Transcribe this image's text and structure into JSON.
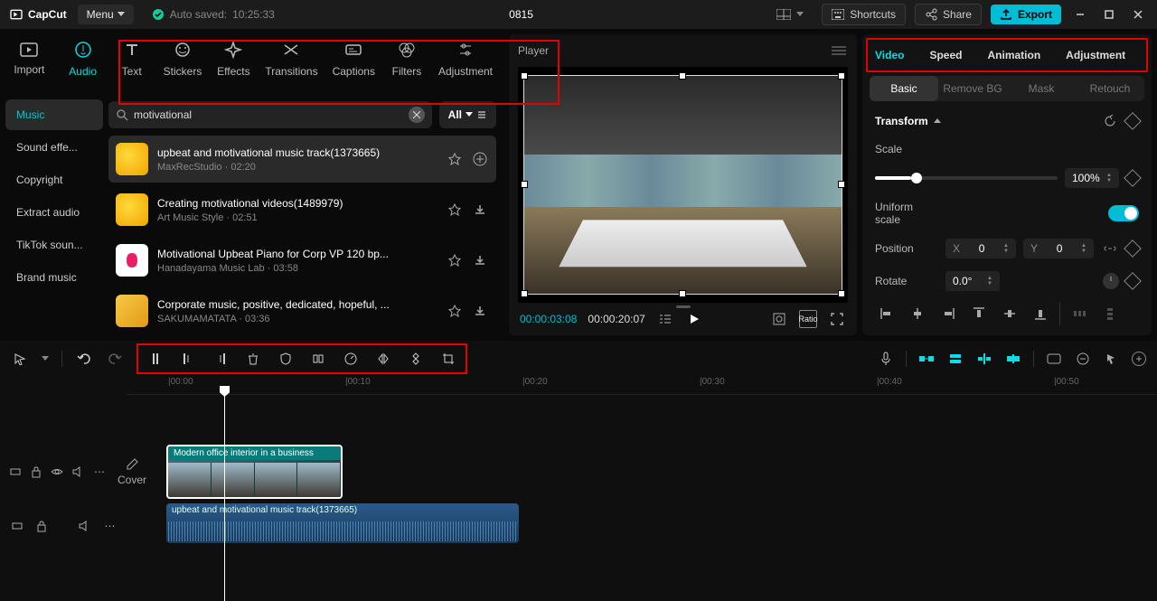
{
  "app": {
    "brand": "CapCut",
    "menu": "Menu",
    "autosave_prefix": "Auto saved:",
    "autosave_time": "10:25:33",
    "project_title": "0815",
    "shortcuts": "Shortcuts",
    "share": "Share",
    "export": "Export"
  },
  "nav": {
    "import": "Import",
    "tabs": [
      "Audio",
      "Text",
      "Stickers",
      "Effects",
      "Transitions",
      "Captions",
      "Filters",
      "Adjustment"
    ]
  },
  "sidebar": {
    "items": [
      "Music",
      "Sound effe...",
      "Copyright",
      "Extract audio",
      "TikTok soun...",
      "Brand music"
    ]
  },
  "search": {
    "value": "motivational",
    "all": "All"
  },
  "tracks": [
    {
      "title": "upbeat and motivational music track(1373665)",
      "artist": "MaxRecStudio",
      "duration": "02:20",
      "thumb": "sun",
      "action": "add"
    },
    {
      "title": "Creating motivational videos(1489979)",
      "artist": "Art Music Style",
      "duration": "02:51",
      "thumb": "sun",
      "action": "download"
    },
    {
      "title": "Motivational Upbeat Piano for Corp VP 120 bp...",
      "artist": "Hanadayama Music Lab",
      "duration": "03:58",
      "thumb": "pink",
      "action": "download"
    },
    {
      "title": "Corporate music, positive, dedicated, hopeful, ...",
      "artist": "SAKUMAMATATA",
      "duration": "03:36",
      "thumb": "yellow",
      "action": "download"
    }
  ],
  "player": {
    "title": "Player",
    "time_current": "00:00:03:08",
    "time_total": "00:00:20:07",
    "ratio": "Ratio"
  },
  "inspector": {
    "tabs": [
      "Video",
      "Speed",
      "Animation",
      "Adjustment"
    ],
    "subtabs": [
      "Basic",
      "Remove BG",
      "Mask",
      "Retouch"
    ],
    "transform": "Transform",
    "scale_label": "Scale",
    "scale_value": "100%",
    "uniform_label": "Uniform scale",
    "position_label": "Position",
    "pos_x_label": "X",
    "pos_x": "0",
    "pos_y_label": "Y",
    "pos_y": "0",
    "rotate_label": "Rotate",
    "rotate_value": "0.0°"
  },
  "timeline": {
    "ruler": [
      "00:00",
      "00:10",
      "00:20",
      "00:30",
      "00:40",
      "00:50"
    ],
    "cover": "Cover",
    "video_clip_label": "Modern office interior in a business",
    "audio_clip_label": "upbeat and motivational music track(1373665)"
  }
}
